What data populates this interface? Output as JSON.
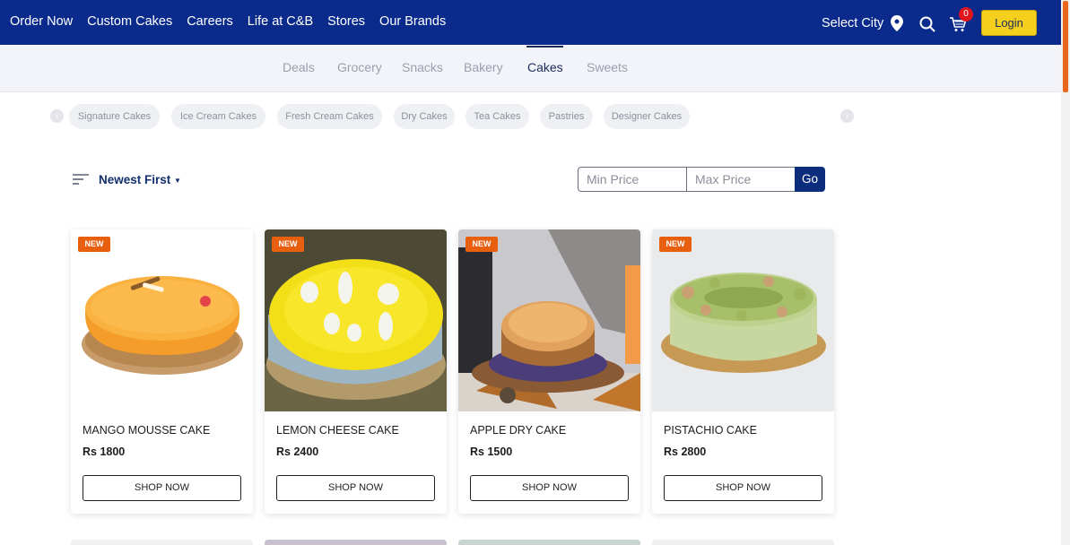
{
  "nav": {
    "links": [
      "Order Now",
      "Custom Cakes",
      "Careers",
      "Life at C&B",
      "Stores",
      "Our Brands"
    ],
    "select_city": "Select City",
    "cart_count": "0",
    "login": "Login"
  },
  "categories": {
    "tabs": [
      "Deals",
      "Grocery",
      "Snacks",
      "Bakery",
      "Cakes",
      "Sweets"
    ],
    "active": "Cakes"
  },
  "subcategories": [
    "Signature Cakes",
    "Ice Cream Cakes",
    "Fresh Cream Cakes",
    "Dry Cakes",
    "Tea Cakes",
    "Pastries",
    "Designer Cakes"
  ],
  "sort": {
    "label": "Newest First"
  },
  "price_filter": {
    "min_placeholder": "Min Price",
    "max_placeholder": "Max Price",
    "go": "Go"
  },
  "products": [
    {
      "badge": "NEW",
      "name": "MANGO MOUSSE CAKE",
      "price": "Rs 1800",
      "cta": "SHOP NOW"
    },
    {
      "badge": "NEW",
      "name": "LEMON CHEESE CAKE",
      "price": "Rs 2400",
      "cta": "SHOP NOW"
    },
    {
      "badge": "NEW",
      "name": "APPLE DRY CAKE",
      "price": "Rs 1500",
      "cta": "SHOP NOW"
    },
    {
      "badge": "NEW",
      "name": "PISTACHIO CAKE",
      "price": "Rs 2800",
      "cta": "SHOP NOW"
    }
  ],
  "colors": {
    "nav_bg": "#0b2b8c",
    "login_bg": "#f5cf1e",
    "badge_bg": "#e8600f",
    "accent_scroll": "#e8671c"
  },
  "icons": [
    "location-pin-icon",
    "search-icon",
    "cart-icon",
    "sort-icon",
    "chevron-left-icon",
    "chevron-right-icon",
    "caret-down-icon"
  ]
}
